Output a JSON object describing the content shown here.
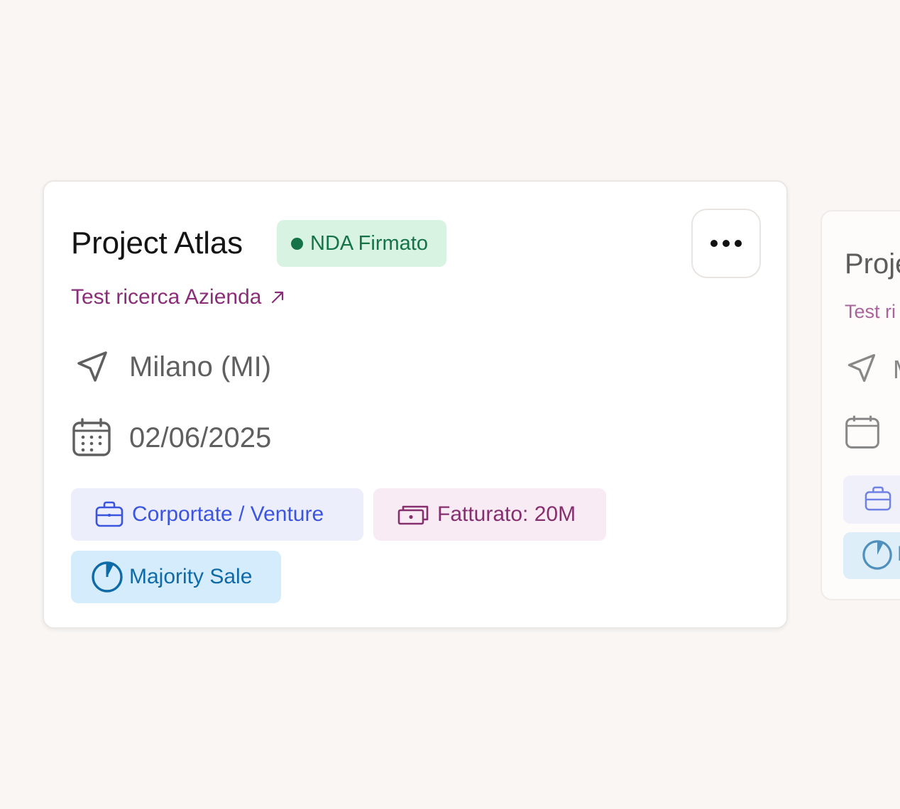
{
  "card": {
    "title": "Project Atlas",
    "status": "NDA Firmato",
    "company_link": "Test ricerca Azienda",
    "location": "Milano (MI)",
    "date": "02/06/2025",
    "tags": {
      "sector": "Corportate / Venture",
      "revenue": "Fatturato: 20M",
      "deal_type": "Majority Sale"
    },
    "more_button_icon": "more-horizontal-icon"
  },
  "next_card": {
    "title": "Proje",
    "company_link": "Test ri",
    "location": "M",
    "tag": "M"
  },
  "colors": {
    "background": "#f9f6f4",
    "status_bg": "#d8f3e2",
    "status_text": "#157347",
    "link": "#8b2e7a",
    "sector_text": "#3b55e0",
    "revenue_text": "#862f6f",
    "deal_text": "#0f6aa8"
  }
}
